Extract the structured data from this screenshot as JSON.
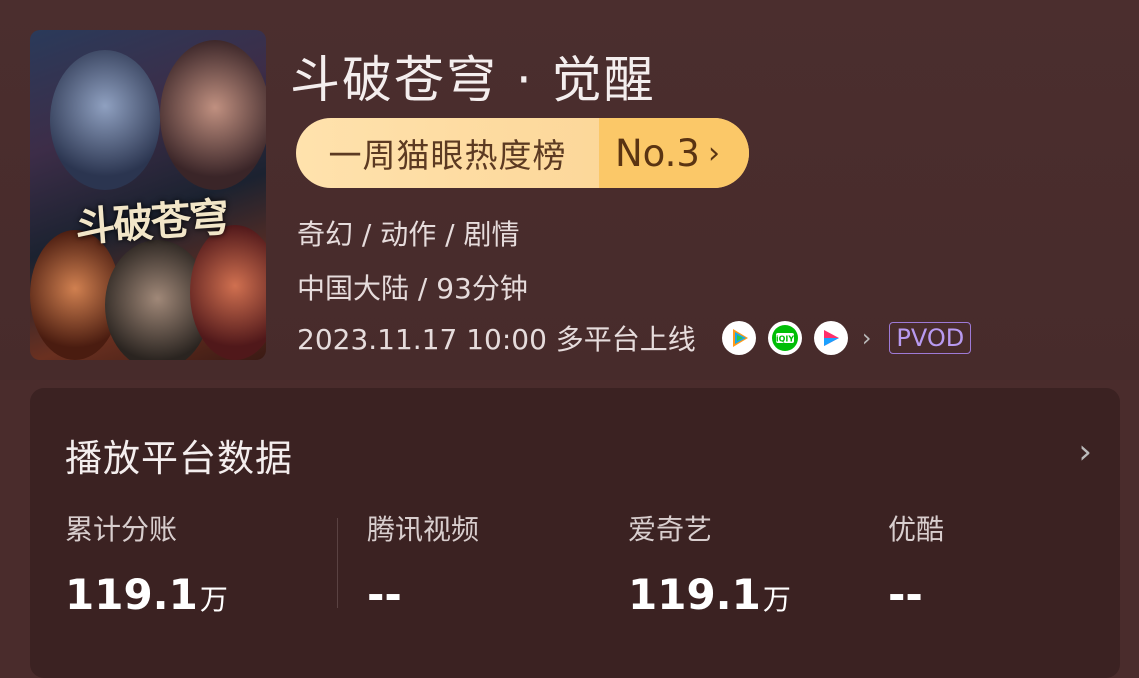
{
  "movie": {
    "poster_title": "斗破苍穹",
    "title": "斗破苍穹 · 觉醒",
    "ranking": {
      "label": "一周猫眼热度榜",
      "rank": "No.3",
      "chevron": "›"
    },
    "genres": "奇幻 / 动作 / 剧情",
    "region_duration": "中国大陆 / 93分钟",
    "release": "2023.11.17 10:00 多平台上线",
    "platforms": [
      {
        "name": "tencent-video",
        "color": "#1aa7e8"
      },
      {
        "name": "iqiyi",
        "color": "#00be06"
      },
      {
        "name": "youku",
        "color": "#ff2e6b"
      }
    ],
    "badge": "PVOD"
  },
  "stats": {
    "title": "播放平台数据",
    "columns": [
      {
        "label": "累计分账",
        "value": "119.1",
        "unit": "万"
      },
      {
        "label": "腾讯视频",
        "value": "--",
        "unit": ""
      },
      {
        "label": "爱奇艺",
        "value": "119.1",
        "unit": "万"
      },
      {
        "label": "优酷",
        "value": "--",
        "unit": ""
      }
    ]
  }
}
